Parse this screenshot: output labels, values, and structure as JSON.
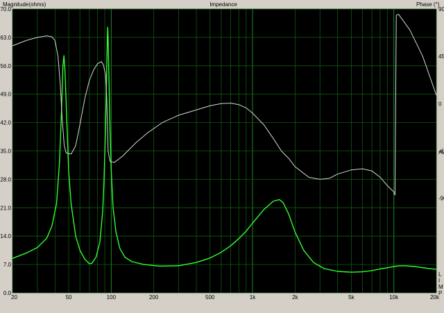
{
  "chart_data": {
    "type": "line",
    "title": "Impedance",
    "ylabel_left": "Magnitude(ohms)",
    "ylabel_right": "Phase (°)",
    "x_scale": "log",
    "xlim": [
      20,
      20000
    ],
    "ylim_left": [
      0,
      70
    ],
    "ylim_right": [
      -180,
      90
    ],
    "grid": true,
    "x_tick_labels": [
      {
        "v": 20,
        "label": "20"
      },
      {
        "v": 50,
        "label": "50"
      },
      {
        "v": 100,
        "label": "100"
      },
      {
        "v": 200,
        "label": "200"
      },
      {
        "v": 500,
        "label": "500"
      },
      {
        "v": 1000,
        "label": "1k"
      },
      {
        "v": 2000,
        "label": "2k"
      },
      {
        "v": 5000,
        "label": "5k"
      },
      {
        "v": 10000,
        "label": "10k"
      },
      {
        "v": 20000,
        "label": "20k"
      }
    ],
    "y_tick_labels_left": [
      "0.0",
      "7.0",
      "14.0",
      "21.0",
      "28.0",
      "35.0",
      "42.0",
      "49.0",
      "56.0",
      "63.0",
      "70.0"
    ],
    "y_tick_labels_right": [
      {
        "v": 90,
        "label": "90"
      },
      {
        "v": 45,
        "label": "45"
      },
      {
        "v": 0,
        "label": "0"
      },
      {
        "v": -45,
        "label": "-45"
      },
      {
        "v": -90,
        "label": "-90"
      }
    ],
    "right_partial_label": "Av",
    "corner_legend": [
      "L",
      "I",
      "M",
      "P"
    ],
    "series": [
      {
        "axis": "left",
        "color": "#33ff33",
        "points": [
          [
            20,
            8.5
          ],
          [
            25,
            9.8
          ],
          [
            30,
            11.2
          ],
          [
            35,
            13.5
          ],
          [
            38,
            16.5
          ],
          [
            41,
            22
          ],
          [
            43,
            32
          ],
          [
            44.5,
            45
          ],
          [
            45.5,
            56
          ],
          [
            46.3,
            58.5
          ],
          [
            47,
            55
          ],
          [
            48.5,
            42
          ],
          [
            50,
            30
          ],
          [
            52,
            22
          ],
          [
            56,
            14
          ],
          [
            60,
            10.5
          ],
          [
            65,
            8.3
          ],
          [
            70,
            7.2
          ],
          [
            73,
            7.3
          ],
          [
            78,
            8.8
          ],
          [
            83,
            12.5
          ],
          [
            87,
            20
          ],
          [
            89,
            28
          ],
          [
            91,
            40
          ],
          [
            92.5,
            52
          ],
          [
            93.5,
            60
          ],
          [
            94.3,
            65.5
          ],
          [
            95,
            63
          ],
          [
            96.5,
            52
          ],
          [
            98,
            40
          ],
          [
            100,
            30
          ],
          [
            103,
            21
          ],
          [
            108,
            15
          ],
          [
            115,
            11
          ],
          [
            125,
            8.8
          ],
          [
            140,
            7.7
          ],
          [
            170,
            7.0
          ],
          [
            220,
            6.6
          ],
          [
            300,
            6.7
          ],
          [
            400,
            7.5
          ],
          [
            500,
            8.6
          ],
          [
            600,
            10.0
          ],
          [
            700,
            11.6
          ],
          [
            800,
            13.4
          ],
          [
            900,
            15.2
          ],
          [
            1000,
            17.2
          ],
          [
            1200,
            20.5
          ],
          [
            1400,
            22.6
          ],
          [
            1550,
            23.0
          ],
          [
            1650,
            22.2
          ],
          [
            1800,
            19.5
          ],
          [
            2000,
            15.0
          ],
          [
            2300,
            10.5
          ],
          [
            2700,
            7.5
          ],
          [
            3200,
            6.0
          ],
          [
            4000,
            5.3
          ],
          [
            5000,
            5.1
          ],
          [
            6000,
            5.2
          ],
          [
            7000,
            5.5
          ],
          [
            8000,
            5.9
          ],
          [
            9000,
            6.2
          ],
          [
            10000,
            6.5
          ],
          [
            11000,
            6.7
          ],
          [
            12000,
            6.7
          ],
          [
            14000,
            6.5
          ],
          [
            17000,
            6.1
          ],
          [
            20000,
            5.8
          ]
        ]
      },
      {
        "axis": "right",
        "color": "#d8d8d8",
        "points": [
          [
            20,
            55
          ],
          [
            25,
            60
          ],
          [
            30,
            63
          ],
          [
            35,
            64.5
          ],
          [
            38,
            63.5
          ],
          [
            40,
            60
          ],
          [
            42,
            45
          ],
          [
            43.5,
            20
          ],
          [
            45,
            -15
          ],
          [
            46.5,
            -40
          ],
          [
            48,
            -47
          ],
          [
            52,
            -48
          ],
          [
            56,
            -40
          ],
          [
            60,
            -20
          ],
          [
            65,
            5
          ],
          [
            70,
            22
          ],
          [
            75,
            32
          ],
          [
            80,
            38
          ],
          [
            85,
            40
          ],
          [
            88,
            37
          ],
          [
            91,
            28
          ],
          [
            93,
            5
          ],
          [
            95,
            -45
          ],
          [
            98,
            -55
          ],
          [
            105,
            -56
          ],
          [
            120,
            -50
          ],
          [
            150,
            -37
          ],
          [
            180,
            -28
          ],
          [
            230,
            -18
          ],
          [
            300,
            -11
          ],
          [
            400,
            -6
          ],
          [
            500,
            -2
          ],
          [
            600,
            0
          ],
          [
            700,
            0.5
          ],
          [
            800,
            -1
          ],
          [
            900,
            -4
          ],
          [
            1000,
            -9
          ],
          [
            1200,
            -20
          ],
          [
            1400,
            -33
          ],
          [
            1600,
            -45
          ],
          [
            1800,
            -52
          ],
          [
            2000,
            -60
          ],
          [
            2500,
            -70
          ],
          [
            3000,
            -72
          ],
          [
            3500,
            -71
          ],
          [
            4000,
            -67
          ],
          [
            5000,
            -63
          ],
          [
            6000,
            -62
          ],
          [
            7000,
            -64
          ],
          [
            8000,
            -70
          ],
          [
            9000,
            -78
          ],
          [
            10000,
            -84
          ],
          [
            10200,
            -87
          ],
          [
            10400,
            84
          ],
          [
            10800,
            85
          ],
          [
            13000,
            70
          ],
          [
            16000,
            45
          ],
          [
            20000,
            8
          ]
        ]
      }
    ]
  }
}
